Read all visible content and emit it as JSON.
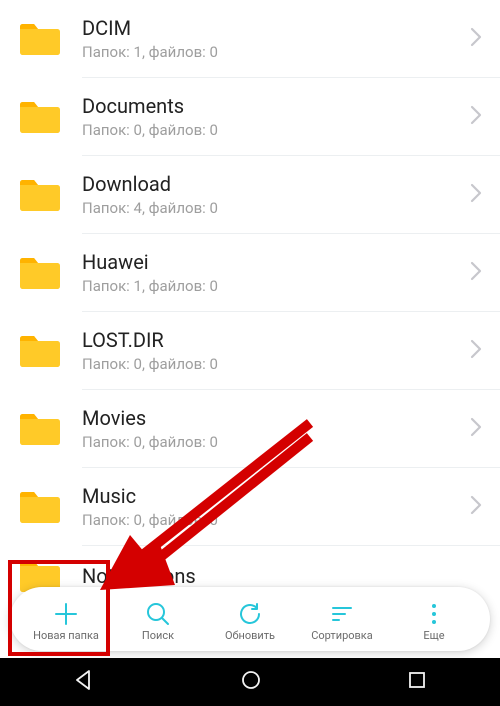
{
  "folders": [
    {
      "name": "DCIM",
      "sub": "Папок: 1, файлов: 0"
    },
    {
      "name": "Documents",
      "sub": "Папок: 0, файлов: 0"
    },
    {
      "name": "Download",
      "sub": "Папок: 4, файлов: 0"
    },
    {
      "name": "Huawei",
      "sub": "Папок: 1, файлов: 0"
    },
    {
      "name": "LOST.DIR",
      "sub": "Папок: 0, файлов: 0"
    },
    {
      "name": "Movies",
      "sub": "Папок: 0, файлов: 0"
    },
    {
      "name": "Music",
      "sub": "Папок: 0, файлов: 0"
    },
    {
      "name": "Notifications",
      "sub": ""
    }
  ],
  "toolbar": {
    "new_folder": "Новая папка",
    "search": "Поиск",
    "refresh": "Обновить",
    "sort": "Сортировка",
    "more": "Еще"
  },
  "colors": {
    "accent": "#26c6da",
    "highlight": "#d40000"
  }
}
